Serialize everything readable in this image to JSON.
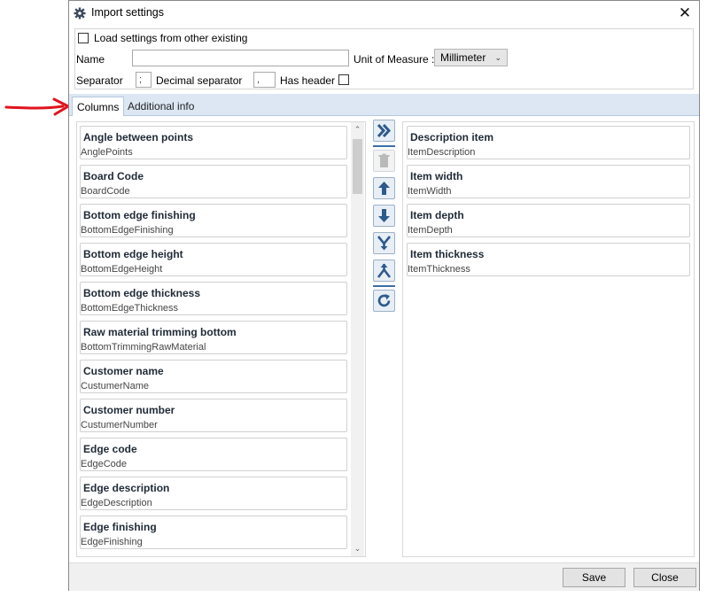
{
  "window": {
    "title": "Import settings",
    "title_icon": "gear-icon",
    "close_glyph": "✕"
  },
  "settings": {
    "load_label": "Load settings from other existing",
    "load_checked": false,
    "name_label": "Name",
    "name_value": "",
    "unit_label": "Unit of Measure :",
    "unit_value": "Millimeter",
    "separator_label": "Separator",
    "separator_value": ";",
    "decimal_label": "Decimal separator",
    "decimal_value": ",",
    "has_header_label": "Has header",
    "has_header_checked": false
  },
  "tabs": [
    {
      "label": "Columns",
      "active": true
    },
    {
      "label": "Additional info",
      "active": false
    }
  ],
  "available_columns": [
    {
      "title": "Angle between points",
      "field": "AnglePoints"
    },
    {
      "title": "Board Code",
      "field": "BoardCode"
    },
    {
      "title": "Bottom edge finishing",
      "field": "BottomEdgeFinishing"
    },
    {
      "title": "Bottom edge height",
      "field": "BottomEdgeHeight"
    },
    {
      "title": "Bottom edge thickness",
      "field": "BottomEdgeThickness"
    },
    {
      "title": "Raw material trimming bottom",
      "field": "BottomTrimmingRawMaterial"
    },
    {
      "title": "Customer name",
      "field": "CustumerName"
    },
    {
      "title": "Customer number",
      "field": "CustumerNumber"
    },
    {
      "title": "Edge code",
      "field": "EdgeCode"
    },
    {
      "title": "Edge description",
      "field": "EdgeDescription"
    },
    {
      "title": "Edge finishing",
      "field": "EdgeFinishing"
    }
  ],
  "selected_columns": [
    {
      "title": "Description item",
      "field": "ItemDescription"
    },
    {
      "title": "Item width",
      "field": "ItemWidth"
    },
    {
      "title": "Item depth",
      "field": "ItemDepth"
    },
    {
      "title": "Item thickness",
      "field": "ItemThickness"
    }
  ],
  "tool_buttons": [
    {
      "name": "add-all-button",
      "icon": "double-chevron-right-icon",
      "enabled": true
    },
    {
      "name": "delete-button",
      "icon": "trash-icon",
      "enabled": false
    },
    {
      "name": "move-up-button",
      "icon": "arrow-up-icon",
      "enabled": true
    },
    {
      "name": "move-down-button",
      "icon": "arrow-down-icon",
      "enabled": true
    },
    {
      "name": "merge-button",
      "icon": "merge-icon",
      "enabled": true
    },
    {
      "name": "split-button",
      "icon": "split-icon",
      "enabled": true
    },
    {
      "name": "reset-button",
      "icon": "refresh-icon",
      "enabled": true
    }
  ],
  "footer": {
    "save_label": "Save",
    "close_label": "Close"
  },
  "colors": {
    "accent": "#3a6ea5",
    "tab_strip": "#dce7f3",
    "annotation_arrow": "#e0141e"
  }
}
